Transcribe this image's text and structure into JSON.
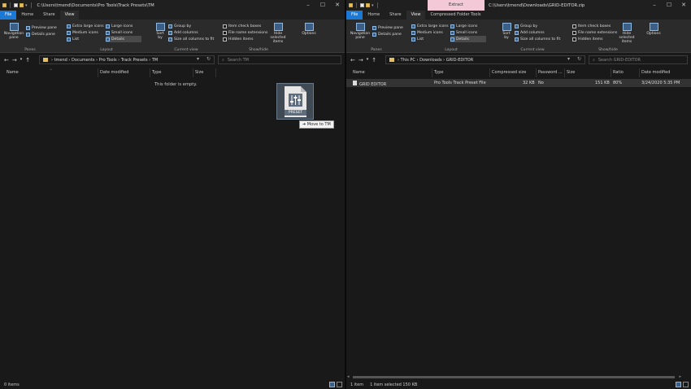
{
  "left": {
    "title_path": "C:\\Users\\tmend\\Documents\\Pro Tools\\Track Presets\\TM",
    "tabs": [
      "File",
      "Home",
      "Share",
      "View"
    ],
    "ribbon": {
      "panes": {
        "nav": "Navigation pane",
        "preview": "Preview pane",
        "details": "Details pane",
        "label": "Panes"
      },
      "layout": {
        "items": [
          "Extra large icons",
          "Medium icons",
          "List",
          "Large icons",
          "Small icons",
          "Details"
        ],
        "label": "Layout"
      },
      "current_view": {
        "sort": "Sort by",
        "group": "Group by",
        "add_columns": "Add columns",
        "size_all": "Size all columns to fit",
        "label": "Current view"
      },
      "show_hide": {
        "item_check": "Item check boxes",
        "file_ext": "File name extensions",
        "hidden": "Hidden items",
        "hide_selected": "Hide selected items",
        "label": "Show/hide"
      },
      "options": "Options"
    },
    "breadcrumb": [
      "tmend",
      "Documents",
      "Pro Tools",
      "Track Presets",
      "TM"
    ],
    "search_placeholder": "Search TM",
    "columns": [
      "Name",
      "Date modified",
      "Type",
      "Size"
    ],
    "empty_text": "This folder is empty.",
    "status": "0 items"
  },
  "right": {
    "context_tab": "Extract",
    "title_path": "C:\\Users\\tmend\\Downloads\\GRID-EDITOR.zip",
    "tabs": [
      "File",
      "Home",
      "Share",
      "View",
      "Compressed Folder Tools"
    ],
    "breadcrumb": [
      "This PC",
      "Downloads",
      "GRID-EDITOR"
    ],
    "search_placeholder": "Search GRID-EDITOR",
    "columns": [
      "Name",
      "Type",
      "Compressed size",
      "Password ...",
      "Size",
      "Ratio",
      "Date modified"
    ],
    "row": {
      "name": "GRID EDITOR",
      "type": "Pro Tools Track Preset File",
      "compressed": "32 KB",
      "password": "No",
      "size": "151 KB",
      "ratio": "80%",
      "date": "3/24/2020 5:35 PM"
    },
    "status_items": "1 item",
    "status_selected": "1 item selected  150 KB"
  },
  "drag": {
    "label": "PRESET",
    "tooltip": "Move to TM"
  }
}
